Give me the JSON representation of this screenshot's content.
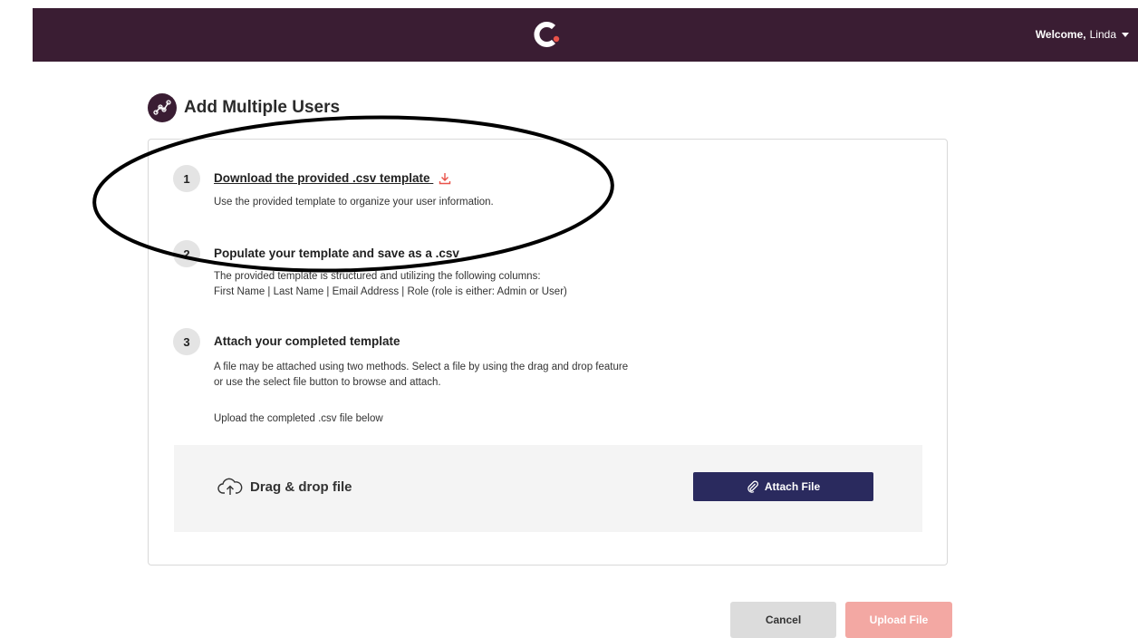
{
  "header": {
    "welcome_prefix": "Welcome,",
    "user_name": "Linda",
    "brand_color": "#3a1d33",
    "logo_icon": "brand-c-logo-icon"
  },
  "page": {
    "title": "Add Multiple Users",
    "title_icon": "graph-nodes-icon"
  },
  "steps": [
    {
      "number": "1",
      "title": "Download the provided .csv template",
      "title_icon": "download-icon",
      "description": [
        "Use the provided template to organize your user information."
      ]
    },
    {
      "number": "2",
      "title": "Populate your template and save as a .csv",
      "description": [
        "The provided template is structured and utilizing the following columns:",
        "First Name | Last Name | Email Address | Role (role is either: Admin or User)"
      ]
    },
    {
      "number": "3",
      "title": "Attach your completed template",
      "description": [
        "A file may be attached using two methods. Select a file by using the drag and drop feature",
        "or use the select file button to browse and attach."
      ],
      "note": "Upload the completed .csv file below"
    }
  ],
  "dropzone": {
    "label": "Drag & drop file",
    "icon": "cloud-upload-icon",
    "attach_label": "Attach File",
    "attach_icon": "paperclip-icon",
    "attach_color": "#2a2a5e"
  },
  "footer": {
    "cancel_label": "Cancel",
    "upload_label": "Upload File",
    "upload_color": "#f3a8a3"
  }
}
